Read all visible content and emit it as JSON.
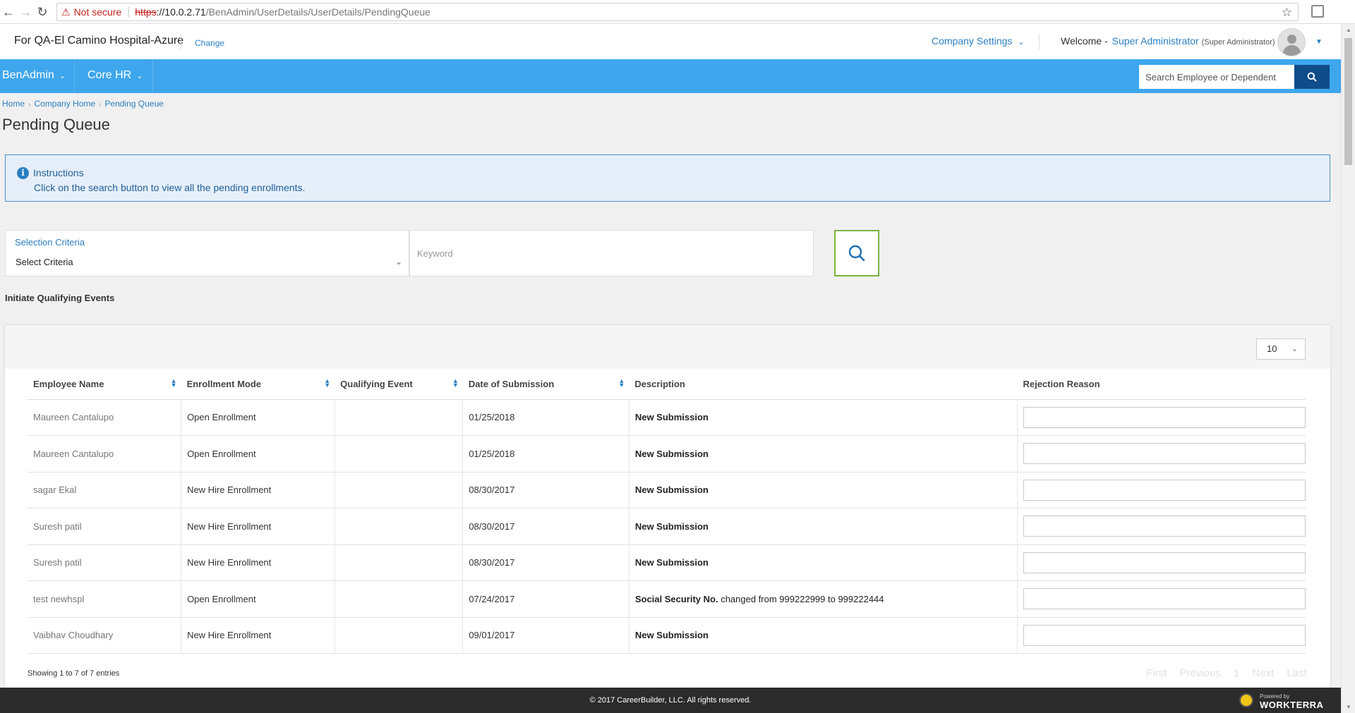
{
  "browser": {
    "back_icon": "←",
    "forward_icon": "→",
    "reload_icon": "↻",
    "warning_icon": "⚠",
    "not_secure": "Not secure",
    "url_scheme": "https",
    "url_host": "://10.0.2.71",
    "url_path": "/BenAdmin/UserDetails/UserDetails/PendingQueue",
    "star_icon": "☆"
  },
  "header": {
    "company_name": "For QA-El Camino Hospital-Azure",
    "change_label": "Change",
    "company_settings": "Company Settings",
    "welcome": "Welcome -",
    "user_name": "Super Administrator",
    "user_role": "(Super Administrator)"
  },
  "nav": {
    "items": [
      {
        "label": "BenAdmin"
      },
      {
        "label": "Core HR"
      }
    ],
    "search_placeholder": "Search Employee or Dependent"
  },
  "breadcrumb": [
    "Home",
    "Company Home",
    "Pending Queue"
  ],
  "page_title": "Pending Queue",
  "instructions": {
    "title": "Instructions",
    "text": "Click on the search button to view all the pending enrollments."
  },
  "filters": {
    "criteria_label": "Selection Criteria",
    "criteria_value": "Select Criteria",
    "keyword_placeholder": "Keyword"
  },
  "initiate_link": "Initiate Qualifying Events",
  "table": {
    "page_size": "10",
    "columns": [
      "Employee Name",
      "Enrollment Mode",
      "Qualifying Event",
      "Date of Submission",
      "Description",
      "Rejection Reason"
    ],
    "rows": [
      {
        "employee": "Maureen Cantalupo",
        "mode": "Open Enrollment",
        "event": "",
        "date": "01/25/2018",
        "desc_bold": "New Submission",
        "desc_rest": ""
      },
      {
        "employee": "Maureen Cantalupo",
        "mode": "Open Enrollment",
        "event": "",
        "date": "01/25/2018",
        "desc_bold": "New Submission",
        "desc_rest": ""
      },
      {
        "employee": "sagar Ekal",
        "mode": "New Hire Enrollment",
        "event": "",
        "date": "08/30/2017",
        "desc_bold": "New Submission",
        "desc_rest": ""
      },
      {
        "employee": "Suresh patil",
        "mode": "New Hire Enrollment",
        "event": "",
        "date": "08/30/2017",
        "desc_bold": "New Submission",
        "desc_rest": ""
      },
      {
        "employee": "Suresh patil",
        "mode": "New Hire Enrollment",
        "event": "",
        "date": "08/30/2017",
        "desc_bold": "New Submission",
        "desc_rest": ""
      },
      {
        "employee": "test newhspl",
        "mode": "Open Enrollment",
        "event": "",
        "date": "07/24/2017",
        "desc_bold": "Social Security No.",
        "desc_rest": " changed from 999222999 to 999222444"
      },
      {
        "employee": "Vaibhav Choudhary",
        "mode": "New Hire Enrollment",
        "event": "",
        "date": "09/01/2017",
        "desc_bold": "New Submission",
        "desc_rest": ""
      }
    ],
    "showing": "Showing 1 to 7 of 7 entries",
    "pager": {
      "first": "First",
      "previous": "Previous",
      "current": "1",
      "next": "Next",
      "last": "Last"
    }
  },
  "footer": {
    "copyright": "© 2017 CareerBuilder, LLC. All rights reserved.",
    "powered_by": "Powered by",
    "brand": "WORKTERRA"
  },
  "colors": {
    "nav_blue": "#3ea6ec",
    "link_blue": "#2a7fc1",
    "search_button": "#0e4c8a",
    "search_border_green": "#7cb342",
    "footer_dark": "#2b2b2b"
  }
}
